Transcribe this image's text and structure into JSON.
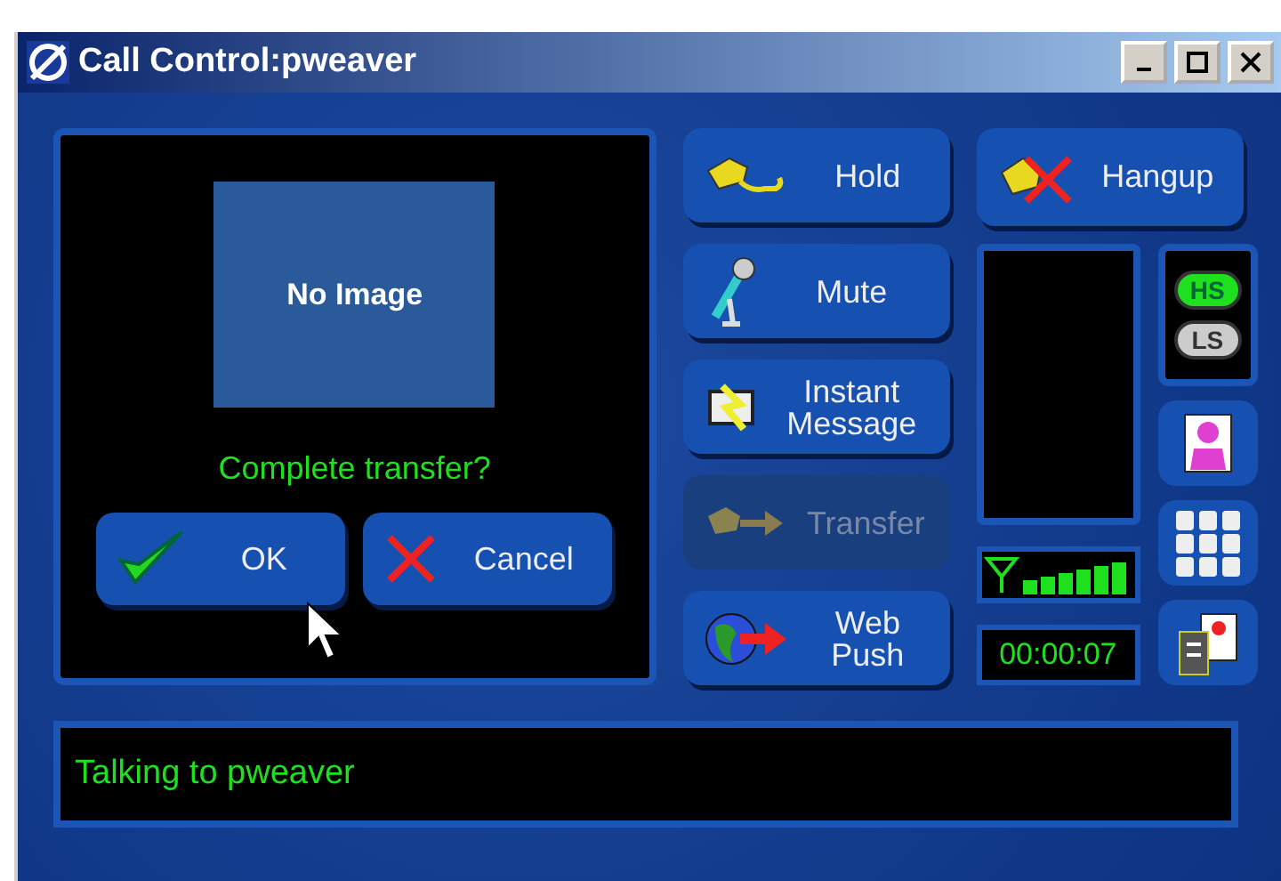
{
  "window": {
    "title": "Call Control:pweaver"
  },
  "preview": {
    "image_text": "No Image",
    "prompt": "Complete transfer?",
    "buttons": [
      {
        "label": "OK",
        "kind": "ok"
      },
      {
        "label": "Cancel",
        "kind": "cancel"
      }
    ]
  },
  "call_buttons": [
    {
      "label": "Hold",
      "kind": "hold",
      "disabled": false
    },
    {
      "label": "Mute",
      "kind": "mute",
      "disabled": false
    },
    {
      "label": "Instant Message",
      "kind": "message",
      "disabled": false
    },
    {
      "label": "Transfer",
      "kind": "transfer",
      "disabled": true
    },
    {
      "label": "Web Push",
      "kind": "web",
      "disabled": false
    }
  ],
  "hangup": {
    "label": "Hangup"
  },
  "audio_modes": [
    {
      "label": "HS",
      "selected": true
    },
    {
      "label": "LS",
      "selected": false
    }
  ],
  "timer": "00:00:07",
  "status_bar": "Talking to pweaver"
}
